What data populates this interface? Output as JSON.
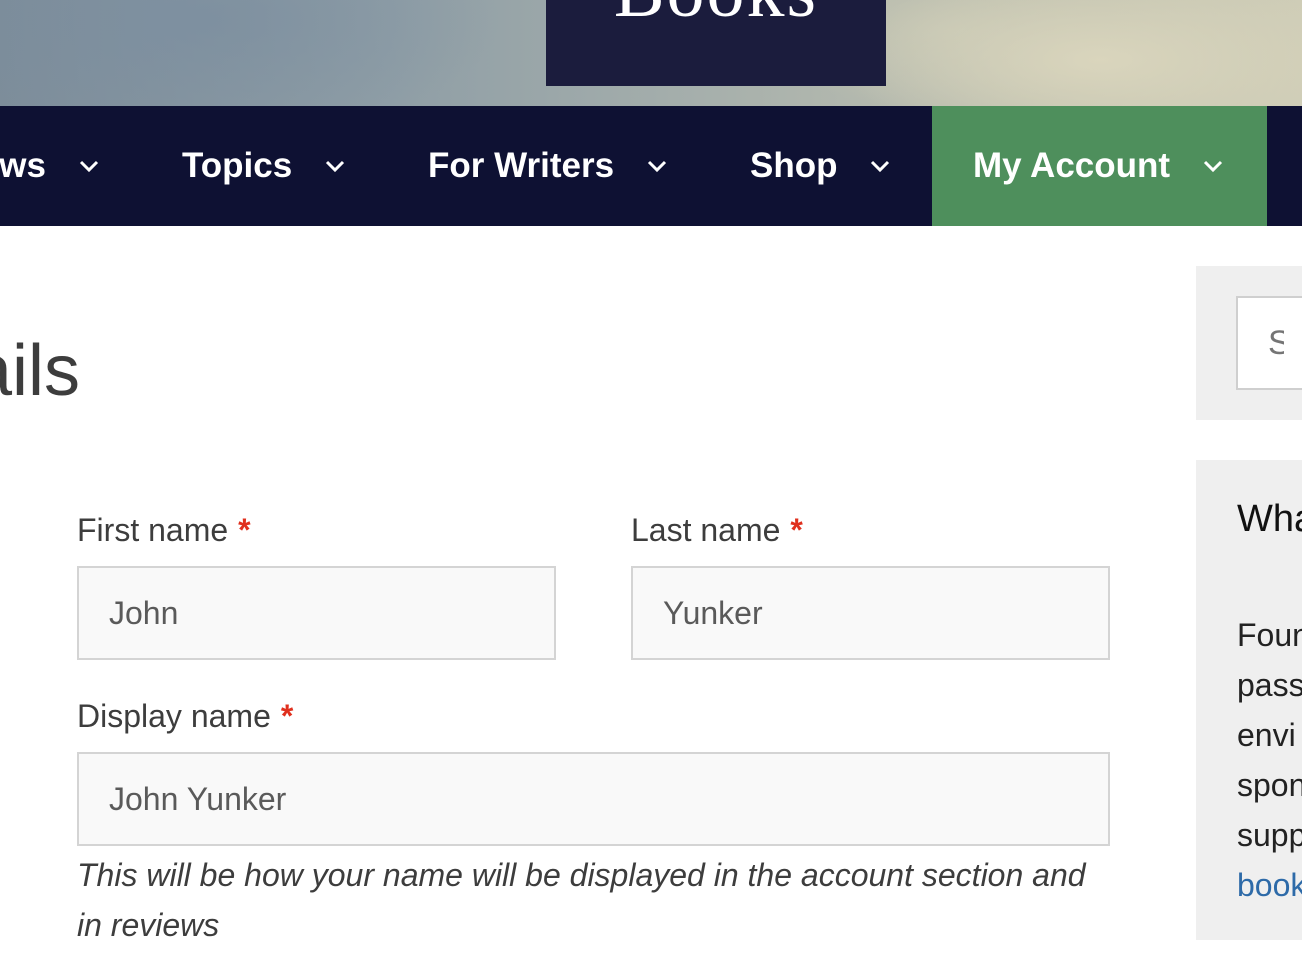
{
  "header": {
    "logo_text": "Books"
  },
  "nav": {
    "items": [
      {
        "label": "News"
      },
      {
        "label": "Topics"
      },
      {
        "label": "For Writers"
      },
      {
        "label": "Shop"
      },
      {
        "label": "My Account"
      }
    ]
  },
  "page": {
    "heading": "Account details"
  },
  "form": {
    "first_name": {
      "label": "First name",
      "value": "John"
    },
    "last_name": {
      "label": "Last name",
      "value": "Yunker"
    },
    "display_name": {
      "label": "Display name",
      "value": "John Yunker"
    },
    "required_mark": "*",
    "display_help": "This will be how your name will be displayed in the account section and in reviews"
  },
  "sidebar": {
    "search_placeholder": "Search",
    "widget_title": "What",
    "widget_lines": [
      "Foun",
      "pass",
      "envi",
      "spon",
      "supp"
    ],
    "widget_link": "book"
  },
  "colors": {
    "nav_bg": "#0e1133",
    "nav_active": "#4e8f5c",
    "required": "#e0301e",
    "link": "#2d6aa8"
  }
}
